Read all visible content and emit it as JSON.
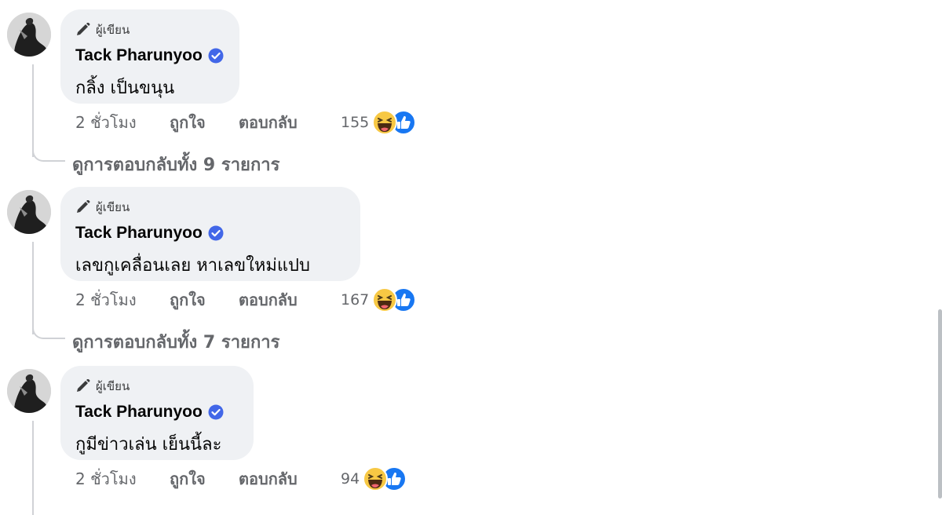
{
  "comments": [
    {
      "author_badge": "ผู้เขียน",
      "author": "Tack Pharunyoo",
      "text": "กลิ้ง เป็นขนุน",
      "time": "2 ชั่วโมง",
      "like_label": "ถูกใจ",
      "reply_label": "ตอบกลับ",
      "reaction_count": "155",
      "view_replies": "ดูการตอบกลับทั้ง 9 รายการ"
    },
    {
      "author_badge": "ผู้เขียน",
      "author": "Tack Pharunyoo",
      "text": "เลขกูเคลื่อนเลย หาเลขใหม่แปบ",
      "time": "2 ชั่วโมง",
      "like_label": "ถูกใจ",
      "reply_label": "ตอบกลับ",
      "reaction_count": "167",
      "view_replies": "ดูการตอบกลับทั้ง 7 รายการ"
    },
    {
      "author_badge": "ผู้เขียน",
      "author": "Tack Pharunyoo",
      "text": "กูมีข่าวเล่น เย็นนี้ละ",
      "time": "2 ชั่วโมง",
      "like_label": "ถูกใจ",
      "reply_label": "ตอบกลับ",
      "reaction_count": "94"
    }
  ],
  "icons": {
    "badge": "pencil-icon",
    "verified": "verified-badge-icon",
    "reactions": [
      "haha-reaction-icon",
      "like-reaction-icon"
    ]
  },
  "colors": {
    "bubble": "#eff1f4",
    "secondary_text": "#65676b",
    "verified_blue": "#4267e8",
    "like_blue": "#1877f2",
    "haha_yellow": "#f7c844"
  }
}
